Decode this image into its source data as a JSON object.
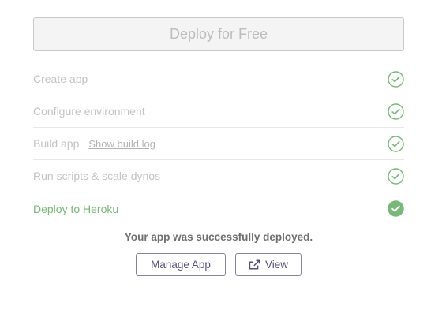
{
  "deploy_button": {
    "label": "Deploy for Free"
  },
  "steps": [
    {
      "label": "Create app",
      "status_icon": "check-circle-outline"
    },
    {
      "label": "Configure environment",
      "status_icon": "check-circle-outline"
    },
    {
      "label": "Build app",
      "link": "Show build log",
      "status_icon": "check-circle-outline"
    },
    {
      "label": "Run scripts & scale dynos",
      "status_icon": "check-circle-outline"
    },
    {
      "label": "Deploy to Heroku",
      "status_icon": "check-circle-filled"
    }
  ],
  "success_message": "Your app was successfully deployed.",
  "actions": {
    "manage_label": "Manage App",
    "view_label": "View",
    "view_icon": "external-link-icon"
  },
  "colors": {
    "success_green": "#79b879",
    "muted_text": "#c3c3c3",
    "button_text": "#5a4f7a"
  }
}
